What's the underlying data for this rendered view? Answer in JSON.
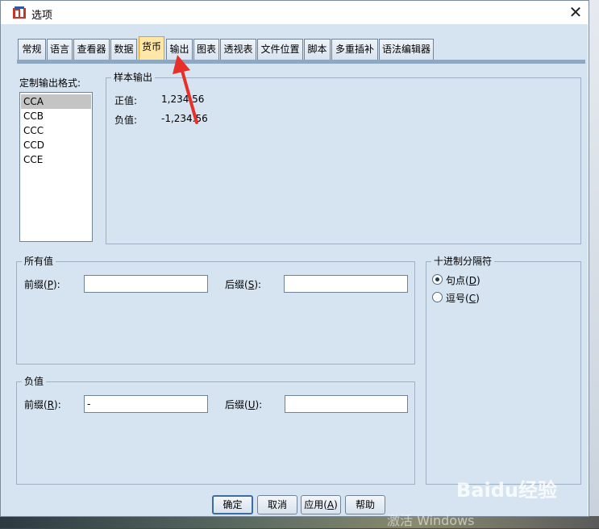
{
  "window": {
    "title": "选项",
    "close_glyph": "✕"
  },
  "tabs": [
    {
      "label": "常规"
    },
    {
      "label": "语言"
    },
    {
      "label": "查看器"
    },
    {
      "label": "数据"
    },
    {
      "label": "货币"
    },
    {
      "label": "输出"
    },
    {
      "label": "图表"
    },
    {
      "label": "透视表"
    },
    {
      "label": "文件位置"
    },
    {
      "label": "脚本"
    },
    {
      "label": "多重插补"
    },
    {
      "label": "语法编辑器"
    }
  ],
  "active_tab": "货币",
  "custom_formats": {
    "label": "定制输出格式:",
    "items": [
      "CCA",
      "CCB",
      "CCC",
      "CCD",
      "CCE"
    ],
    "selected": "CCA"
  },
  "sample_output": {
    "title": "样本输出",
    "positive_label": "正值:",
    "positive_value": "1,234.56",
    "negative_label": "负值:",
    "negative_value": "-1,234.56"
  },
  "all_values": {
    "title": "所有值",
    "prefix_label_pre": "前缀(",
    "prefix_key": "P",
    "prefix_label_post": "):",
    "prefix_value": "",
    "suffix_label_pre": "后缀(",
    "suffix_key": "S",
    "suffix_label_post": "):",
    "suffix_value": ""
  },
  "negative_values": {
    "title": "负值",
    "prefix_label_pre": "前缀(",
    "prefix_key": "R",
    "prefix_label_post": "):",
    "prefix_value": "-",
    "suffix_label_pre": "后缀(",
    "suffix_key": "U",
    "suffix_label_post": "):",
    "suffix_value": ""
  },
  "decimal_separator": {
    "title": "十进制分隔符",
    "options": [
      {
        "pre": "句点(",
        "key": "D",
        "post": ")",
        "checked": true
      },
      {
        "pre": "逗号(",
        "key": "C",
        "post": ")",
        "checked": false
      }
    ]
  },
  "buttons": {
    "ok": "确定",
    "cancel": "取消",
    "apply_pre": "应用(",
    "apply_key": "A",
    "apply_post": ")",
    "help": "帮助"
  },
  "annotation": {
    "arrow_color": "#e8302a"
  },
  "watermark": {
    "brand": "Baidu经验",
    "sub": "激活 Windows"
  }
}
